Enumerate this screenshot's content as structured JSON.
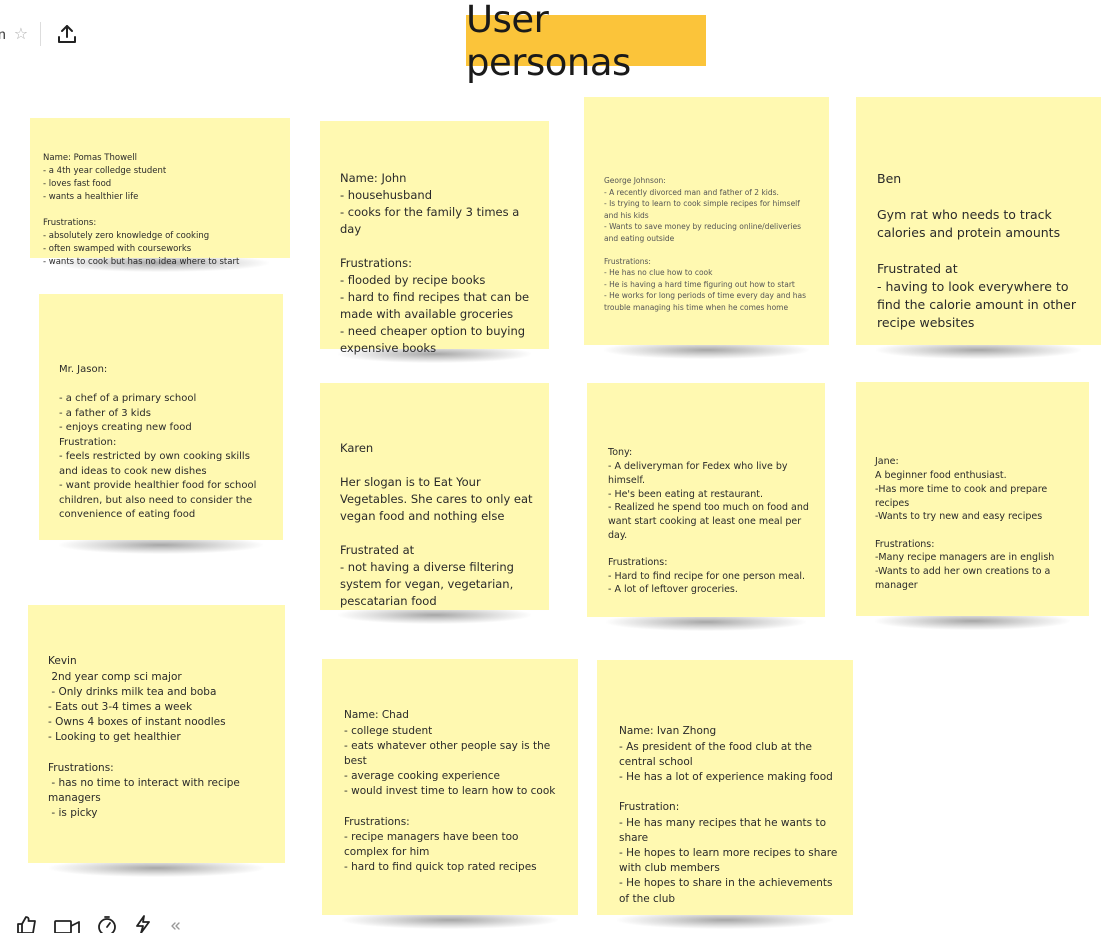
{
  "header": {
    "board_name": "n",
    "title": "User personas"
  },
  "notes": [
    {
      "id": "pomas",
      "text": "Name: Pomas Thowell\n- a 4th year colledge student\n- loves fast food\n- wants a healthier life\n\nFrustrations:\n- absolutely zero knowledge of cooking\n- often swamped with courseworks\n- wants to cook but has no idea where to start"
    },
    {
      "id": "john",
      "text": "Name: John\n- househusband\n- cooks for the family 3 times a day\n\nFrustrations:\n- flooded by recipe books\n- hard to find recipes that can be made with available groceries\n- need cheaper option to buying expensive books"
    },
    {
      "id": "george",
      "text": "George Johnson:\n- A recently divorced man and father of 2 kids.\n- Is trying to learn to cook simple recipes for himself and his kids\n- Wants to save money by reducing online/deliveries and eating outside\n\nFrustrations:\n- He has no clue how to cook\n- He is having a hard time figuring out how to start\n- He works for long periods of time every day and has trouble managing his time when he comes home"
    },
    {
      "id": "ben",
      "text": "Ben\n\nGym rat who needs to track calories and protein amounts\n\nFrustrated at\n- having to look everywhere to find the calorie amount in other recipe websites"
    },
    {
      "id": "jason",
      "text": "Mr. Jason:\n\n- a chef of a primary school\n- a father of 3 kids\n- enjoys creating new food\nFrustration:\n- feels restricted by own cooking skills and ideas to cook new dishes\n- want provide healthier food for school children, but also need to consider the convenience of eating food"
    },
    {
      "id": "karen",
      "text": "Karen\n\nHer slogan is to Eat Your Vegetables. She cares to only eat vegan food and nothing else\n\nFrustrated at\n- not having a diverse filtering system for vegan, vegetarian, pescatarian food"
    },
    {
      "id": "tony",
      "text": "Tony:\n- A deliveryman for Fedex who live by himself.\n- He's been eating at restaurant.\n- Realized he spend too much on food and want start cooking at least one meal per day.\n\nFrustrations:\n- Hard to find recipe for one person meal.\n- A lot of leftover groceries."
    },
    {
      "id": "jane",
      "text": "Jane:\nA beginner food enthusiast.\n-Has more time to cook and prepare recipes\n-Wants to try new and easy recipes\n\nFrustrations:\n-Many recipe managers are in english\n-Wants to add her own creations to a manager"
    },
    {
      "id": "kevin",
      "text": "Kevin\n 2nd year comp sci major\n - Only drinks milk tea and boba\n- Eats out 3-4 times a week\n- Owns 4 boxes of instant noodles\n- Looking to get healthier\n\nFrustrations:\n - has no time to interact with recipe managers\n - is picky"
    },
    {
      "id": "chad",
      "text": "Name: Chad\n- college student\n- eats whatever other people say is the best\n- average cooking experience\n- would invest time to learn how to cook\n\nFrustrations:\n- recipe managers have been too complex for him\n- hard to find quick top rated recipes"
    },
    {
      "id": "ivan",
      "text": "Name: Ivan Zhong\n- As president of the food club at the central school\n- He has a lot of experience making food\n\nFrustration:\n- He has many recipes that he wants to share\n- He hopes to learn more recipes to share with club members\n- He hopes to share in the achievements of the club"
    }
  ],
  "icons": {
    "star": "star-icon",
    "share": "upload-icon",
    "bottom": [
      "thumbs-up-icon",
      "video-camera-icon",
      "timer-icon",
      "lightning-icon",
      "collapse-chevrons-icon"
    ]
  },
  "colors": {
    "note": "#fff9b1",
    "title_highlight": "#fbc43a"
  }
}
